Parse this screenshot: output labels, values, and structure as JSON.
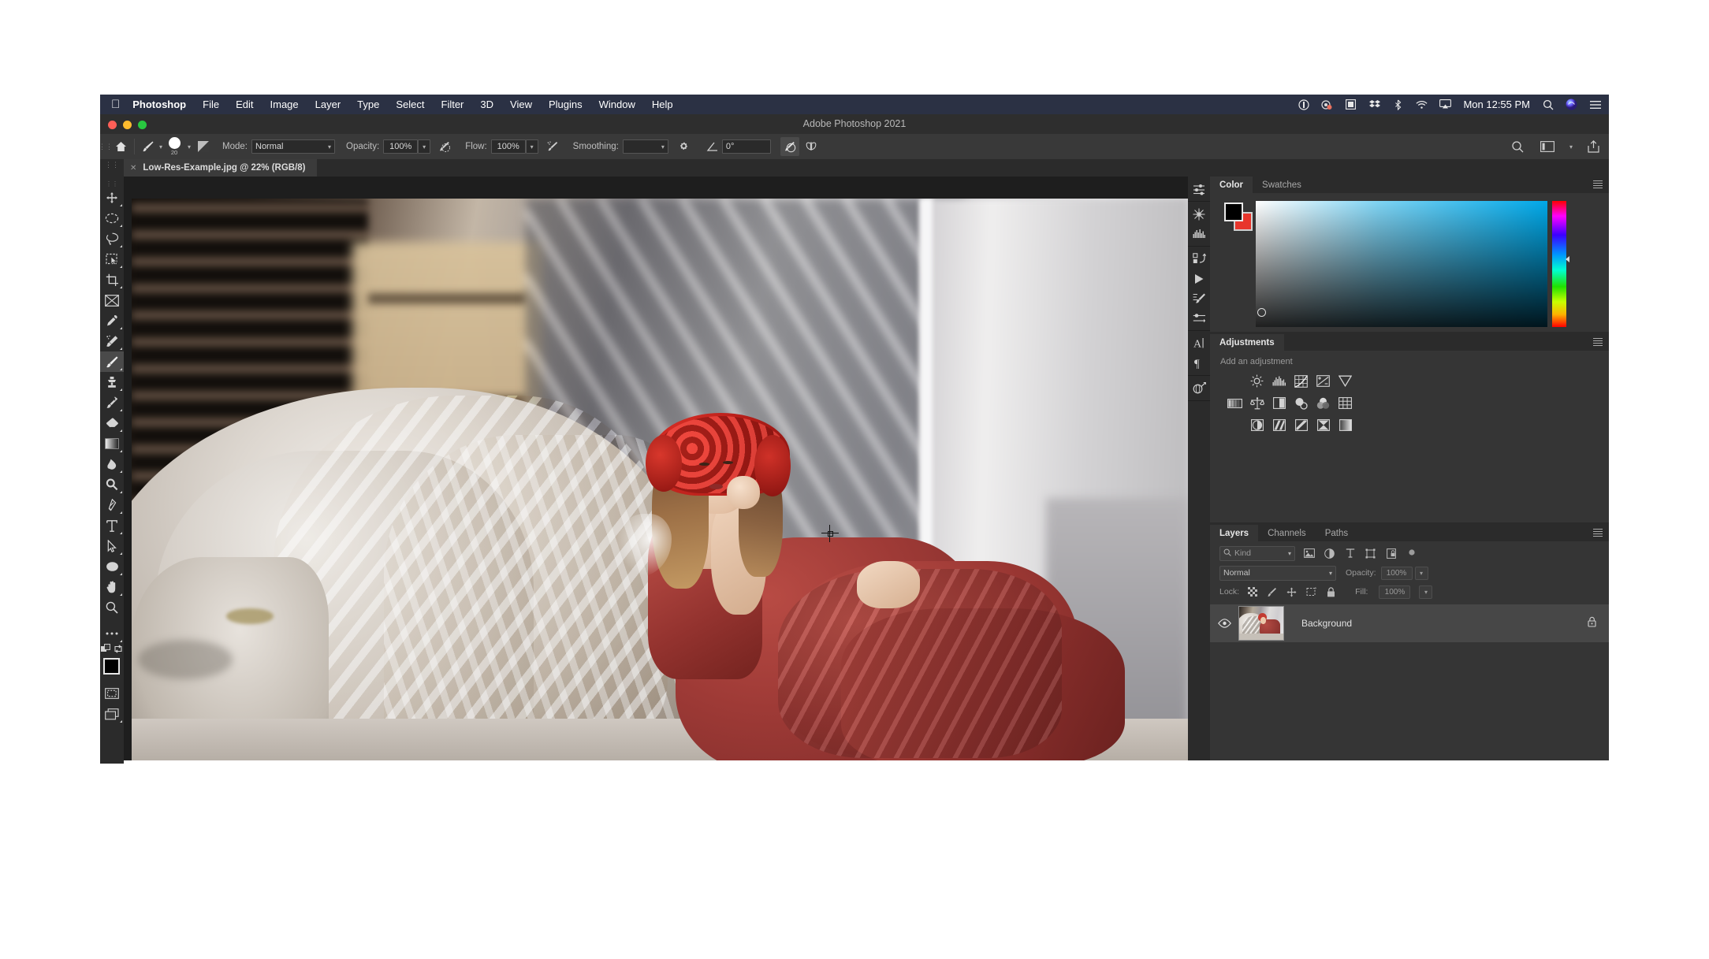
{
  "macbar": {
    "apple_icon": "apple-icon",
    "items": [
      {
        "label": "Photoshop",
        "bold": true
      },
      {
        "label": "File",
        "bold": false
      },
      {
        "label": "Edit",
        "bold": false
      },
      {
        "label": "Image",
        "bold": false
      },
      {
        "label": "Layer",
        "bold": false
      },
      {
        "label": "Type",
        "bold": false
      },
      {
        "label": "Select",
        "bold": false
      },
      {
        "label": "Filter",
        "bold": false
      },
      {
        "label": "3D",
        "bold": false
      },
      {
        "label": "View",
        "bold": false
      },
      {
        "label": "Plugins",
        "bold": false
      },
      {
        "label": "Window",
        "bold": false
      },
      {
        "label": "Help",
        "bold": false
      }
    ],
    "status_icons": [
      "timemachine-icon",
      "screenshot-icon",
      "display-mirror-icon",
      "dropbox-icon",
      "bluetooth-icon",
      "wifi-icon",
      "airplay-icon"
    ],
    "clock": "Mon 12:55 PM",
    "spotlight_icon": "search-icon",
    "siri_icon": "siri-icon",
    "controlcenter_icon": "list-icon"
  },
  "window": {
    "title": "Adobe Photoshop 2021",
    "close_label": "close",
    "minimize_label": "minimize",
    "zoom_label": "zoom"
  },
  "options_bar": {
    "home_icon": "home-icon",
    "tool_icon": "brush-icon",
    "brush_size": "20",
    "brush_preset_icon": "brush-preset-icon",
    "mode_label": "Mode:",
    "mode_value": "Normal",
    "opacity_label": "Opacity:",
    "opacity_value": "100%",
    "opacity_pressure_icon": "pressure-opacity-icon",
    "flow_label": "Flow:",
    "flow_value": "100%",
    "airbrush_icon": "airbrush-icon",
    "smoothing_label": "Smoothing:",
    "smoothing_value": "",
    "smoothing_gear_icon": "gear-icon",
    "angle_icon": "angle-icon",
    "angle_value": "0°",
    "pressure_size_icon": "pressure-size-icon",
    "symmetry_icon": "symmetry-butterfly-icon",
    "search_icon": "search-icon",
    "workspace_icon": "workspace-icon",
    "share_icon": "share-icon"
  },
  "document_tab": {
    "close_icon": "close-icon",
    "title": "Low-Res-Example.jpg @ 22% (RGB/8)"
  },
  "toolbar": {
    "tools": [
      {
        "name": "move-tool",
        "label": "Move Tool",
        "has_flyout": true,
        "active": false
      },
      {
        "name": "marquee-tool",
        "label": "Elliptical Marquee Tool",
        "has_flyout": true,
        "active": false
      },
      {
        "name": "lasso-tool",
        "label": "Lasso Tool",
        "has_flyout": true,
        "active": false
      },
      {
        "name": "object-selection-tool",
        "label": "Object Selection Tool",
        "has_flyout": true,
        "active": false
      },
      {
        "name": "crop-tool",
        "label": "Crop Tool",
        "has_flyout": true,
        "active": false
      },
      {
        "name": "frame-tool",
        "label": "Frame Tool",
        "has_flyout": false,
        "active": false
      },
      {
        "name": "eyedropper-tool",
        "label": "Eyedropper Tool",
        "has_flyout": true,
        "active": false
      },
      {
        "name": "spot-healing-brush-tool",
        "label": "Spot Healing Brush Tool",
        "has_flyout": true,
        "active": false
      },
      {
        "name": "brush-tool",
        "label": "Brush Tool",
        "has_flyout": true,
        "active": true
      },
      {
        "name": "clone-stamp-tool",
        "label": "Clone Stamp Tool",
        "has_flyout": true,
        "active": false
      },
      {
        "name": "history-brush-tool",
        "label": "History Brush Tool",
        "has_flyout": true,
        "active": false
      },
      {
        "name": "eraser-tool",
        "label": "Eraser Tool",
        "has_flyout": true,
        "active": false
      },
      {
        "name": "gradient-tool",
        "label": "Gradient Tool",
        "has_flyout": true,
        "active": false
      },
      {
        "name": "blur-tool",
        "label": "Blur Tool",
        "has_flyout": true,
        "active": false
      },
      {
        "name": "dodge-tool",
        "label": "Dodge Tool",
        "has_flyout": true,
        "active": false
      },
      {
        "name": "pen-tool",
        "label": "Pen Tool",
        "has_flyout": true,
        "active": false
      },
      {
        "name": "type-tool",
        "label": "Horizontal Type Tool",
        "has_flyout": true,
        "active": false
      },
      {
        "name": "path-selection-tool",
        "label": "Path Selection Tool",
        "has_flyout": true,
        "active": false
      },
      {
        "name": "shape-tool",
        "label": "Ellipse Tool",
        "has_flyout": true,
        "active": false
      },
      {
        "name": "hand-tool",
        "label": "Hand Tool",
        "has_flyout": true,
        "active": false
      },
      {
        "name": "zoom-tool",
        "label": "Zoom Tool",
        "has_flyout": false,
        "active": false
      },
      {
        "name": "edit-toolbar-tool",
        "label": "Edit Toolbar",
        "has_flyout": true,
        "active": false
      }
    ],
    "default_colors_icon": "default-colors-icon",
    "swap_colors_icon": "swap-colors-icon",
    "foreground_color": "#000000",
    "background_color": "#e8362c",
    "quick_mask_icon": "quick-mask-icon",
    "screen_mode_icon": "screen-mode-icon"
  },
  "rail": {
    "icons": [
      "sliders-icon",
      "adjustments-snowflake-icon",
      "histogram-icon",
      "actions-icon",
      "play-icon",
      "brush-settings-icon",
      "brush-presets-icon",
      "character-icon",
      "paragraph-icon",
      "3d-materials-icon"
    ]
  },
  "color_panel": {
    "tabs": [
      {
        "label": "Color",
        "active": true
      },
      {
        "label": "Swatches",
        "active": false
      }
    ],
    "menu_icon": "panel-menu-icon",
    "foreground_color": "#000000",
    "background_color": "#e8362c",
    "ramp_name": "color-ramp",
    "hue_slider_name": "hue-slider"
  },
  "adjustments_panel": {
    "tabs": [
      {
        "label": "Adjustments",
        "active": true
      }
    ],
    "menu_icon": "panel-menu-icon",
    "hint": "Add an adjustment",
    "rows": [
      [
        {
          "name": "brightness-contrast-adjustment",
          "label": "Brightness/Contrast"
        },
        {
          "name": "levels-adjustment",
          "label": "Levels"
        },
        {
          "name": "curves-adjustment",
          "label": "Curves"
        },
        {
          "name": "exposure-adjustment",
          "label": "Exposure"
        },
        {
          "name": "vibrance-adjustment",
          "label": "Vibrance"
        }
      ],
      [
        {
          "name": "hue-saturation-adjustment",
          "label": "Hue/Saturation"
        },
        {
          "name": "color-balance-adjustment",
          "label": "Color Balance"
        },
        {
          "name": "black-white-adjustment",
          "label": "Black & White"
        },
        {
          "name": "photo-filter-adjustment",
          "label": "Photo Filter"
        },
        {
          "name": "channel-mixer-adjustment",
          "label": "Channel Mixer"
        },
        {
          "name": "color-lookup-adjustment",
          "label": "Color Lookup"
        }
      ],
      [
        {
          "name": "invert-adjustment",
          "label": "Invert"
        },
        {
          "name": "posterize-adjustment",
          "label": "Posterize"
        },
        {
          "name": "threshold-adjustment",
          "label": "Threshold"
        },
        {
          "name": "gradient-map-adjustment",
          "label": "Gradient Map"
        },
        {
          "name": "selective-color-adjustment",
          "label": "Selective Color"
        }
      ]
    ]
  },
  "layers_panel": {
    "tabs": [
      {
        "label": "Layers",
        "active": true
      },
      {
        "label": "Channels",
        "active": false
      },
      {
        "label": "Paths",
        "active": false
      }
    ],
    "menu_icon": "panel-menu-icon",
    "filter_kind_label": "Kind",
    "filter_search_icon": "search-icon",
    "filter_icons": [
      "filter-pixel-icon",
      "filter-adjustment-icon",
      "filter-type-icon",
      "filter-shape-icon",
      "filter-smart-object-icon"
    ],
    "filter_toggle_icon": "filter-toggle-icon",
    "blend_mode": "Normal",
    "opacity_label": "Opacity:",
    "opacity_value": "100%",
    "lock_label": "Lock:",
    "lock_icons": [
      "lock-transparent-pixels-icon",
      "lock-image-pixels-icon",
      "lock-position-icon",
      "lock-artboard-icon",
      "lock-all-icon"
    ],
    "fill_label": "Fill:",
    "fill_value": "100%",
    "layers": [
      {
        "name": "Background",
        "visible": true,
        "locked": true,
        "visibility_icon": "eye-icon",
        "lock_icon": "lock-icon",
        "thumbnail_name": "layer-thumbnail"
      }
    ]
  },
  "canvas": {
    "document_name": "Low-Res-Example.jpg",
    "zoom": "22%",
    "color_mode": "RGB/8",
    "cursor_name": "brush-crosshair-cursor",
    "image_description": "Woman in red dress with red flower crown seated on a stone lion statue"
  },
  "colors": {
    "macbar_bg": "#2b3144",
    "titlebar_bg": "#2e2e2e",
    "options_bar_bg": "#393939",
    "panel_bg": "#353535",
    "dock_bg": "#2b2b2b",
    "canvas_bg": "#1e1e1e",
    "accent_red": "#e8362c",
    "text_primary": "#e6e6e6",
    "text_secondary": "#9a9a9a"
  }
}
